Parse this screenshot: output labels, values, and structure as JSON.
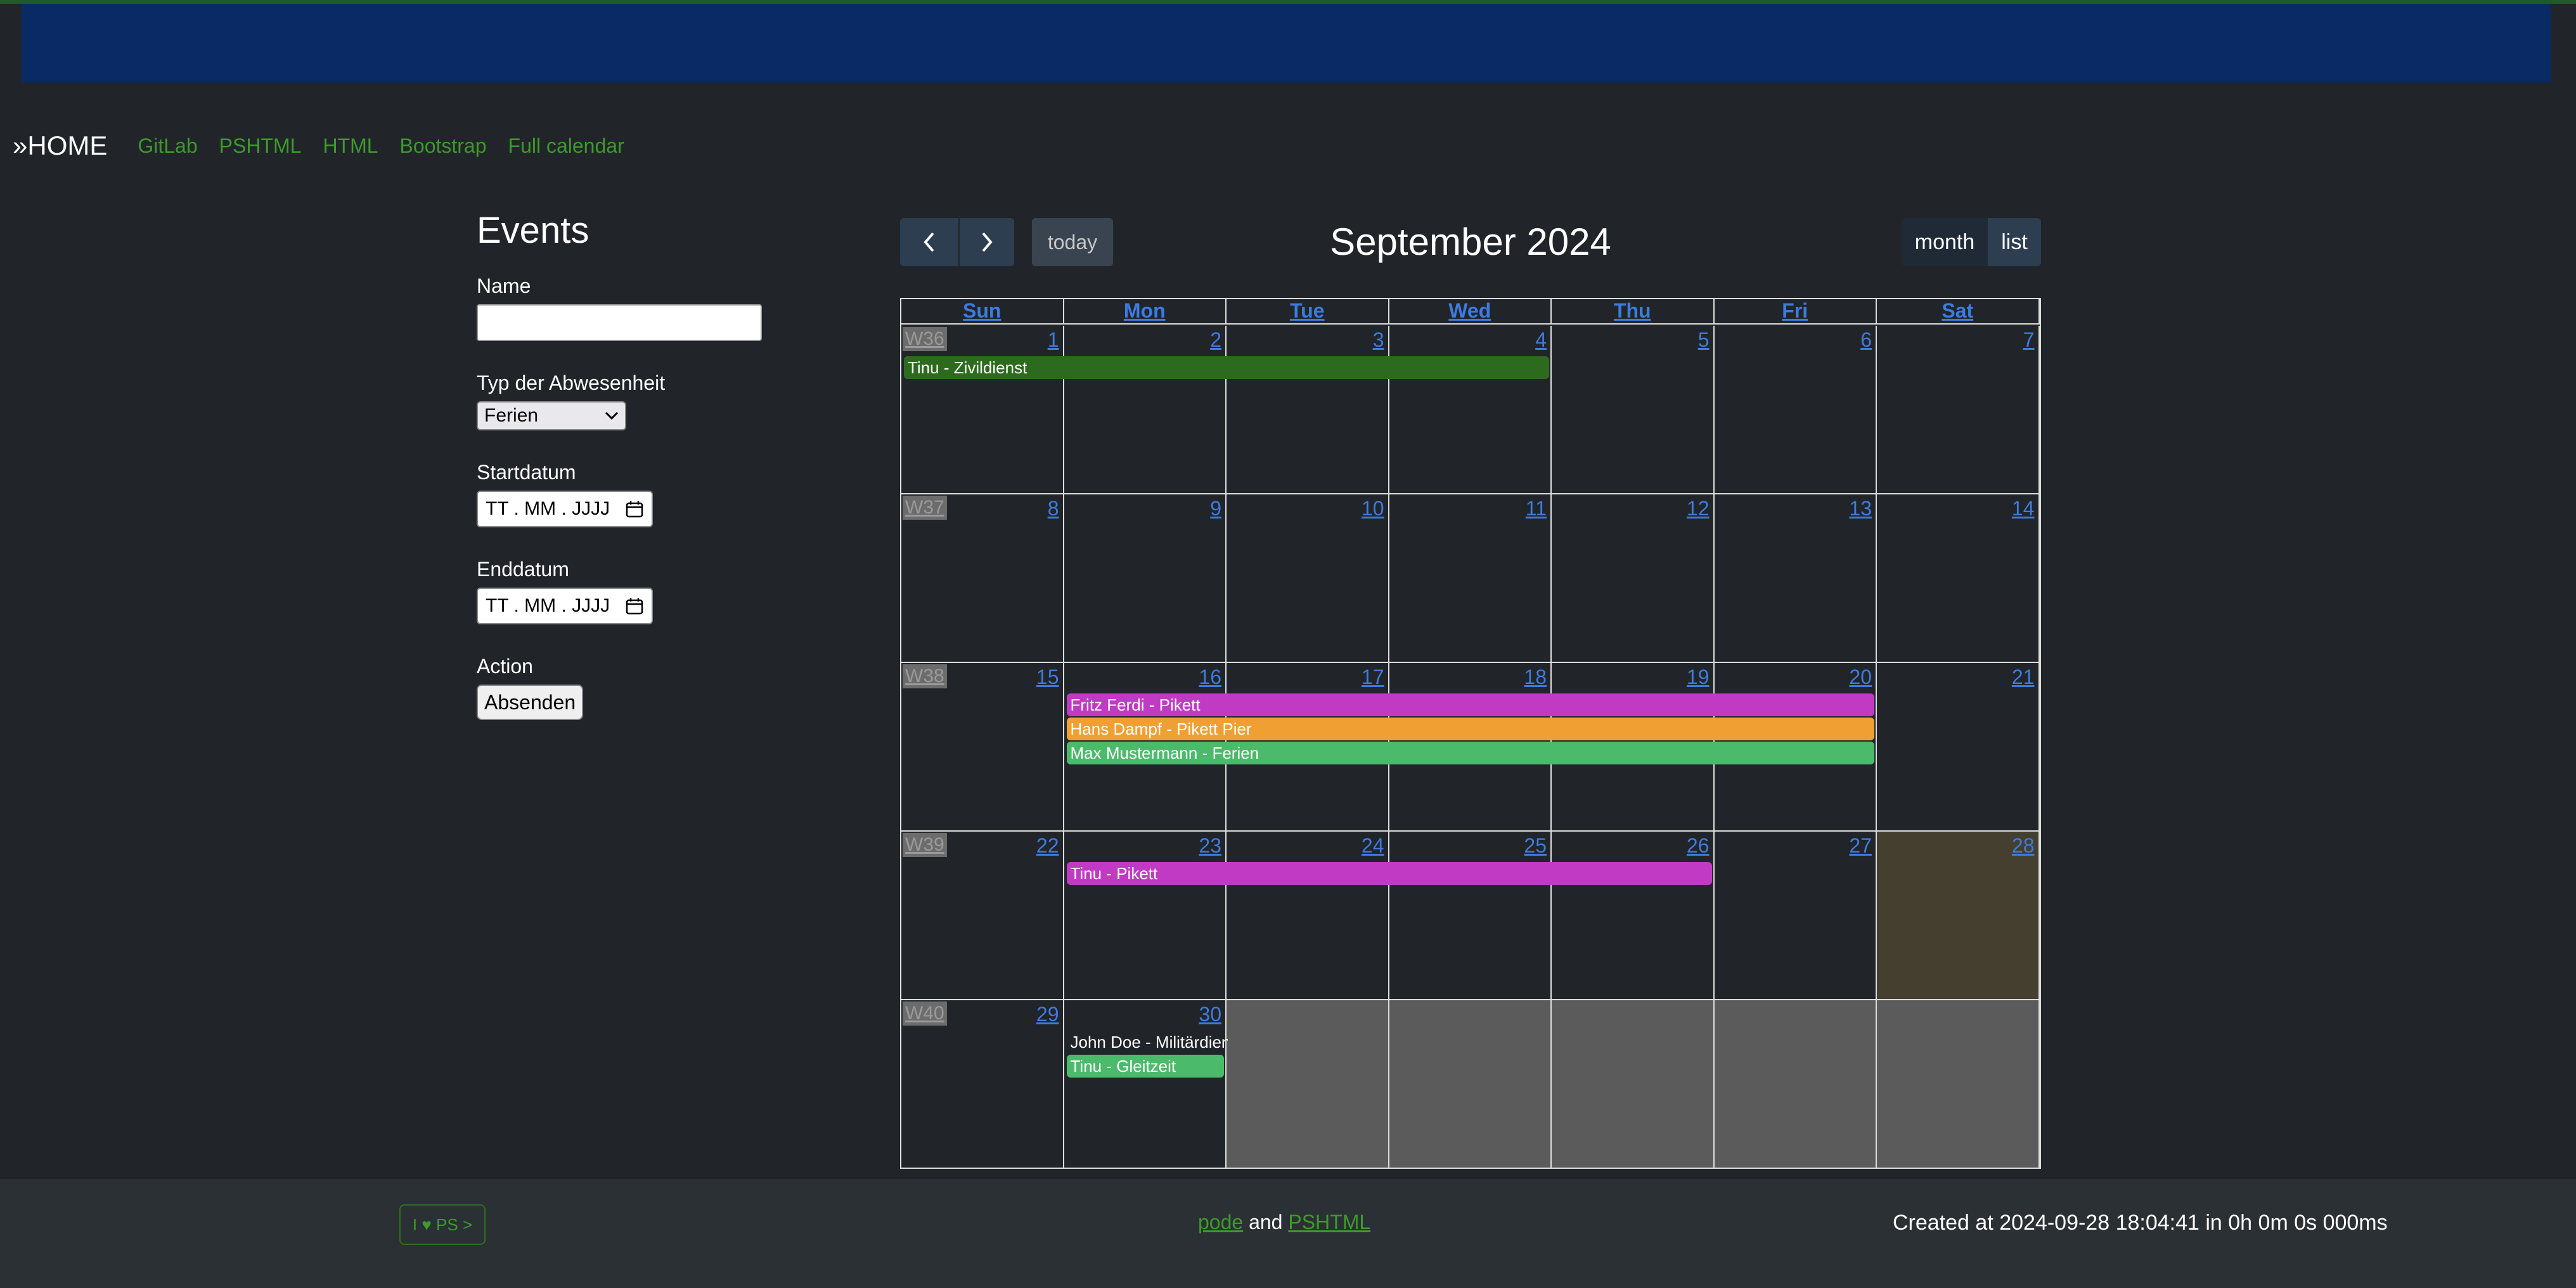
{
  "nav": {
    "home": "»HOME",
    "links": [
      "GitLab",
      "PSHTML",
      "HTML",
      "Bootstrap",
      "Full calendar"
    ]
  },
  "form": {
    "title": "Events",
    "name_label": "Name",
    "name_value": "",
    "type_label": "Typ der Abwesenheit",
    "type_selected": "Ferien",
    "start_label": "Startdatum",
    "start_placeholder": "TT . MM . JJJJ",
    "end_label": "Enddatum",
    "end_placeholder": "TT . MM . JJJJ",
    "action_label": "Action",
    "submit_label": "Absenden"
  },
  "calendar": {
    "title": "September 2024",
    "today_label": "today",
    "view_month": "month",
    "view_list": "list",
    "weekdays": [
      "Sun",
      "Mon",
      "Tue",
      "Wed",
      "Thu",
      "Fri",
      "Sat"
    ],
    "weeks": [
      {
        "label": "W36",
        "days": [
          "1",
          "2",
          "3",
          "4",
          "5",
          "6",
          "7"
        ]
      },
      {
        "label": "W37",
        "days": [
          "8",
          "9",
          "10",
          "11",
          "12",
          "13",
          "14"
        ]
      },
      {
        "label": "W38",
        "days": [
          "15",
          "16",
          "17",
          "18",
          "19",
          "20",
          "21"
        ]
      },
      {
        "label": "W39",
        "days": [
          "22",
          "23",
          "24",
          "25",
          "26",
          "27",
          "28"
        ]
      },
      {
        "label": "W40",
        "days": [
          "29",
          "30",
          "",
          "",
          "",
          "",
          ""
        ]
      }
    ],
    "today": "28",
    "events": [
      {
        "title": "Tinu - Zivildienst",
        "color": "#2c6b1e"
      },
      {
        "title": "Fritz Ferdi - Pikett",
        "color": "#c03ac4"
      },
      {
        "title": "Hans Dampf - Pikett Pier",
        "color": "#f0a032"
      },
      {
        "title": "Max Mustermann - Ferien",
        "color": "#4cba6b"
      },
      {
        "title": "Tinu - Pikett",
        "color": "#c03ac4"
      },
      {
        "title": "John Doe - Militärdienst",
        "color": "#2c6b1e"
      },
      {
        "title": "Tinu - Gleitzeit",
        "color": "#4cba6b"
      }
    ]
  },
  "footer": {
    "badge": "I ♥ PS >",
    "link1": "pode",
    "and": "and",
    "link2": "PSHTML",
    "created": "Created at 2024-09-28 18:04:41 in 0h 0m 0s 000ms"
  }
}
